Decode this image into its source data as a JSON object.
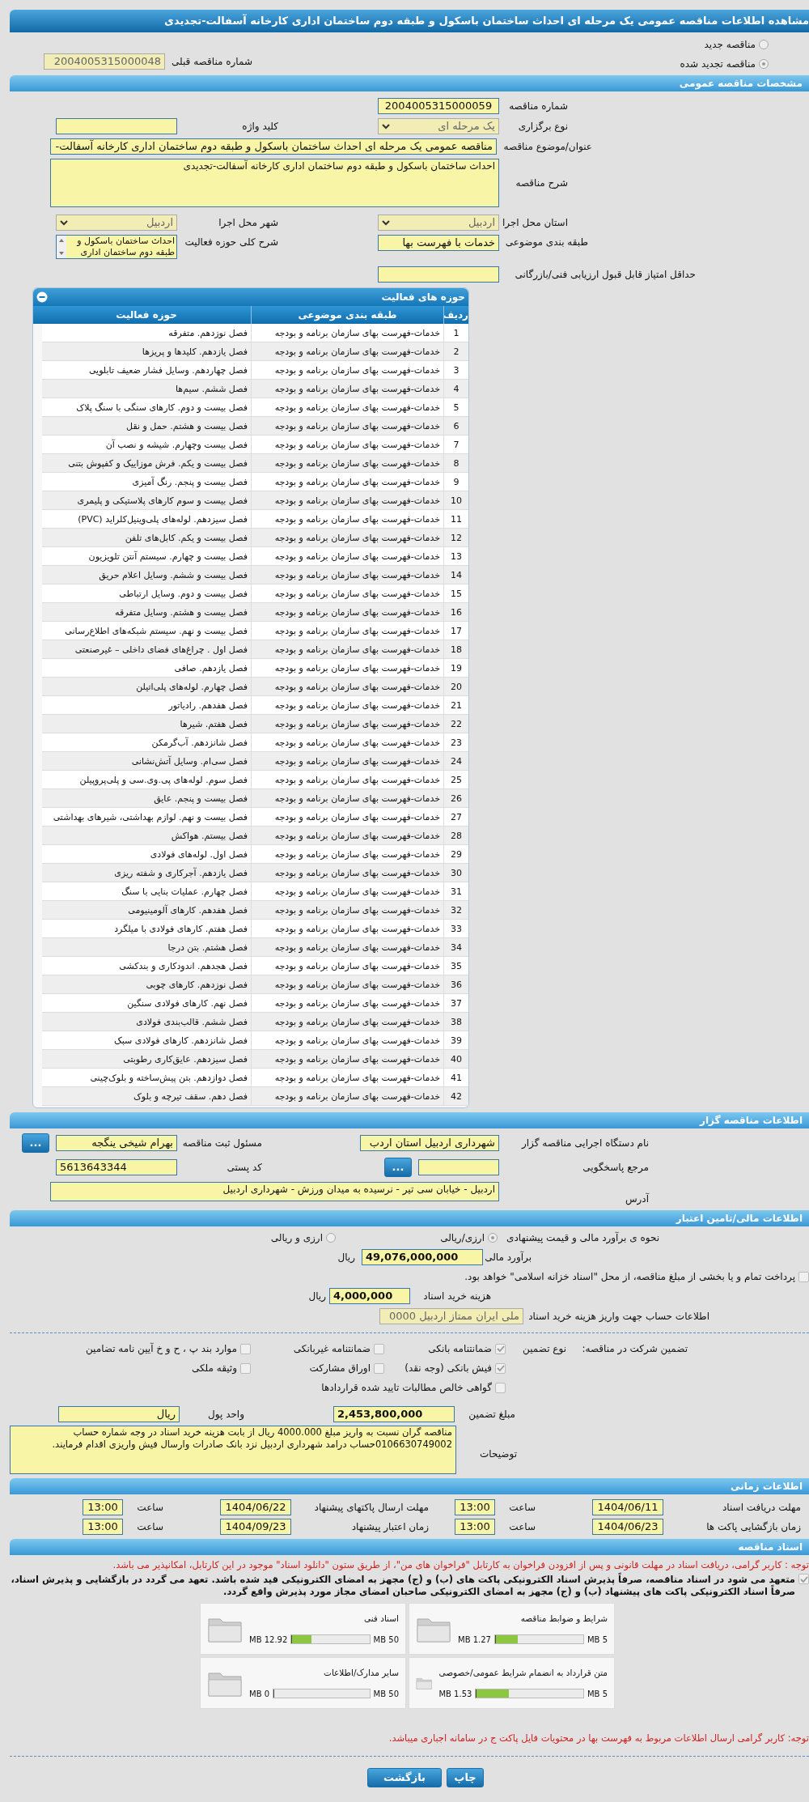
{
  "page_title": "مشاهده اطلاعات مناقصه عمومی یک مرحله ای احداث ساختمان باسکول و طبقه دوم ساختمان اداری کارخانه آسفالت-تجدیدی",
  "tender_status": [
    {
      "label": "مناقصه جدید",
      "selected": false
    },
    {
      "label": "مناقصه تجدید شده",
      "selected": true
    }
  ],
  "previous_tender": {
    "label": "شماره مناقصه قبلی",
    "value": "2004005315000048"
  },
  "general": {
    "title": "مشخصات مناقصه عمومی",
    "tender_number": {
      "label": "شماره مناقصه",
      "value": "2004005315000059"
    },
    "holding_type": {
      "label": "نوع برگزاری",
      "value": "یک مرحله ای"
    },
    "keyword": {
      "label": "کلید واژه"
    },
    "subject": {
      "label": "عنوان/موضوع مناقصه",
      "value": "مناقصه عمومی یک مرحله ای احداث ساختمان باسکول و طبقه دوم ساختمان اداری کارخانه آسفالت-"
    },
    "description": {
      "label": "شرح مناقصه",
      "value": "احداث ساختمان باسکول و طبقه دوم ساختمان اداری کارخانه آسفالت-تجدیدی"
    },
    "province": {
      "label": "استان محل اجرا",
      "value": "اردبیل"
    },
    "city": {
      "label": "شهر محل اجرا",
      "value": "اردبیل"
    },
    "category": {
      "label": "طبقه بندی موضوعی",
      "value": "خدمات با فهرست بها"
    },
    "activity_summary": {
      "label": "شرح کلی حوزه فعالیت",
      "value": "احداث ساختمان باسکول و طبقه دوم ساختمان اداری"
    },
    "min_score": {
      "label": "حداقل امتیاز قابل قبول ارزیابی فنی/بازرگانی"
    }
  },
  "activities": {
    "title": "حوزه های فعالیت",
    "columns": [
      "ردیف",
      "طبقه بندی موضوعی",
      "حوزه فعالیت"
    ],
    "rows": [
      {
        "no": "1",
        "category": "خدمات-فهرست بهای سازمان برنامه و بودجه",
        "activity": "فصل نوزدهم. متفرقه"
      },
      {
        "no": "2",
        "category": "خدمات-فهرست بهای سازمان برنامه و بودجه",
        "activity": "فصل یازدهم. کلیدها و پریزها"
      },
      {
        "no": "3",
        "category": "خدمات-فهرست بهای سازمان برنامه و بودجه",
        "activity": "فصل چهاردهم. وسایل فشار ضعیف تابلویی"
      },
      {
        "no": "4",
        "category": "خدمات-فهرست بهای سازمان برنامه و بودجه",
        "activity": "فصل ششم. سیم‌ها"
      },
      {
        "no": "5",
        "category": "خدمات-فهرست بهای سازمان برنامه و بودجه",
        "activity": "فصل بیست و دوم. کارهای سنگی با سنگ پلاک"
      },
      {
        "no": "6",
        "category": "خدمات-فهرست بهای سازمان برنامه و بودجه",
        "activity": "فصل بیست و هشتم. حمل و نقل"
      },
      {
        "no": "7",
        "category": "خدمات-فهرست بهای سازمان برنامه و بودجه",
        "activity": "فصل بیست وچهارم. شیشه و نصب آن"
      },
      {
        "no": "8",
        "category": "خدمات-فهرست بهای سازمان برنامه و بودجه",
        "activity": "فصل بیست و یکم. فرش موزاییک و کفپوش بتنی"
      },
      {
        "no": "9",
        "category": "خدمات-فهرست بهای سازمان برنامه و بودجه",
        "activity": "فصل بیست و پنجم. رنگ آمیزی"
      },
      {
        "no": "10",
        "category": "خدمات-فهرست بهای سازمان برنامه و بودجه",
        "activity": "فصل بیست و سوم کارهای پلاستیکی و پلیمری"
      },
      {
        "no": "11",
        "category": "خدمات-فهرست بهای سازمان برنامه و بودجه",
        "activity": "فصل سیزدهم. لوله‌های پلی‌وینیل‌کلراید (PVC)"
      },
      {
        "no": "12",
        "category": "خدمات-فهرست بهای سازمان برنامه و بودجه",
        "activity": "فصل بیست و یکم. کابل‌های تلفن"
      },
      {
        "no": "13",
        "category": "خدمات-فهرست بهای سازمان برنامه و بودجه",
        "activity": "فصل بیست و چهارم. سیستم آنتن تلویزیون"
      },
      {
        "no": "14",
        "category": "خدمات-فهرست بهای سازمان برنامه و بودجه",
        "activity": "فصل بیست و ششم. وسایل اعلام حریق"
      },
      {
        "no": "15",
        "category": "خدمات-فهرست بهای سازمان برنامه و بودجه",
        "activity": "فصل بیست و دوم. وسایل ارتباطی"
      },
      {
        "no": "16",
        "category": "خدمات-فهرست بهای سازمان برنامه و بودجه",
        "activity": "فصل بیست و هشتم. وسایل متفرقه"
      },
      {
        "no": "17",
        "category": "خدمات-فهرست بهای سازمان برنامه و بودجه",
        "activity": "فصل بیست و نهم. سیستم شبکه‌های اطلاع‌رسانی"
      },
      {
        "no": "18",
        "category": "خدمات-فهرست بهای سازمان برنامه و بودجه",
        "activity": "فصل اول . چراغ‌های فضای داخلی – غیرصنعتی"
      },
      {
        "no": "19",
        "category": "خدمات-فهرست بهای سازمان برنامه و بودجه",
        "activity": "فصل یازدهم. صافی"
      },
      {
        "no": "20",
        "category": "خدمات-فهرست بهای سازمان برنامه و بودجه",
        "activity": "فصل چهارم. لوله‌های پلی‌اتیلن"
      },
      {
        "no": "21",
        "category": "خدمات-فهرست بهای سازمان برنامه و بودجه",
        "activity": "فصل هفدهم. رادیاتور"
      },
      {
        "no": "22",
        "category": "خدمات-فهرست بهای سازمان برنامه و بودجه",
        "activity": "فصل هفتم. شیرها"
      },
      {
        "no": "23",
        "category": "خدمات-فهرست بهای سازمان برنامه و بودجه",
        "activity": "فصل شانزدهم. آب‌گرمکن"
      },
      {
        "no": "24",
        "category": "خدمات-فهرست بهای سازمان برنامه و بودجه",
        "activity": "فصل سی‌ام. وسایل آتش‌نشانی"
      },
      {
        "no": "25",
        "category": "خدمات-فهرست بهای سازمان برنامه و بودجه",
        "activity": "فصل سوم. لوله‌های پی.وی.سی و پلی‌پروپیلن"
      },
      {
        "no": "26",
        "category": "خدمات-فهرست بهای سازمان برنامه و بودجه",
        "activity": "فصل بیست و پنجم. عایق"
      },
      {
        "no": "27",
        "category": "خدمات-فهرست بهای سازمان برنامه و بودجه",
        "activity": "فصل بیست و نهم. لوازم بهداشتی، شیرهای بهداشتی"
      },
      {
        "no": "28",
        "category": "خدمات-فهرست بهای سازمان برنامه و بودجه",
        "activity": "فصل بیستم. هواکش"
      },
      {
        "no": "29",
        "category": "خدمات-فهرست بهای سازمان برنامه و بودجه",
        "activity": "فصل اول. لوله‌های فولادی"
      },
      {
        "no": "30",
        "category": "خدمات-فهرست بهای سازمان برنامه و بودجه",
        "activity": "فصل یازدهم. آجرکاری و شفته ریزی"
      },
      {
        "no": "31",
        "category": "خدمات-فهرست بهای سازمان برنامه و بودجه",
        "activity": "فصل چهارم. عملیات بنایی با سنگ"
      },
      {
        "no": "32",
        "category": "خدمات-فهرست بهای سازمان برنامه و بودجه",
        "activity": "فصل هفدهم. کارهای آلومینیومی"
      },
      {
        "no": "33",
        "category": "خدمات-فهرست بهای سازمان برنامه و بودجه",
        "activity": "فصل هفتم. کارهای فولادی با میلگرد"
      },
      {
        "no": "34",
        "category": "خدمات-فهرست بهای سازمان برنامه و بودجه",
        "activity": "فصل هشتم. بتن درجا"
      },
      {
        "no": "35",
        "category": "خدمات-فهرست بهای سازمان برنامه و بودجه",
        "activity": "فصل هجدهم. اندودکاری و بندکشی"
      },
      {
        "no": "36",
        "category": "خدمات-فهرست بهای سازمان برنامه و بودجه",
        "activity": "فصل نوزدهم. کارهای چوبی"
      },
      {
        "no": "37",
        "category": "خدمات-فهرست بهای سازمان برنامه و بودجه",
        "activity": "فصل نهم. کارهای فولادی سنگین"
      },
      {
        "no": "38",
        "category": "خدمات-فهرست بهای سازمان برنامه و بودجه",
        "activity": "فصل ششم. قالب‌بندی فولادی"
      },
      {
        "no": "39",
        "category": "خدمات-فهرست بهای سازمان برنامه و بودجه",
        "activity": "فصل شانزدهم. کارهای فولادی سبک"
      },
      {
        "no": "40",
        "category": "خدمات-فهرست بهای سازمان برنامه و بودجه",
        "activity": "فصل سیزدهم. عایق‌کاری رطوبتی"
      },
      {
        "no": "41",
        "category": "خدمات-فهرست بهای سازمان برنامه و بودجه",
        "activity": "فصل دوازدهم. بتن پیش‌ساخته و بلوک‌چینی"
      },
      {
        "no": "42",
        "category": "خدمات-فهرست بهای سازمان برنامه و بودجه",
        "activity": "فصل دهم. سقف تیرچه و بلوک"
      }
    ]
  },
  "organizer": {
    "title": "اطلاعات مناقصه گزار",
    "organization": {
      "label": "نام دستگاه اجرایی مناقصه گزار",
      "value": "شهرداری اردبیل استان اردب"
    },
    "registrar": {
      "label": "مسئول ثبت مناقصه",
      "value": "بهرام شیخی ینگجه",
      "button": "..."
    },
    "reference": {
      "label": "مرجع پاسخگویی",
      "button": "..."
    },
    "postal_code": {
      "label": "کد پستی",
      "value": "5613643344"
    },
    "address": {
      "label": "آدرس",
      "value": "اردبیل - خیابان سی تیر - نرسیده به میدان ورزش - شهرداری اردبیل"
    }
  },
  "finance": {
    "title": "اطلاعات مالی/تامین اعتبار",
    "estimate_method": {
      "label": "نحوه ی برآورد مالی و قیمت پیشنهادی",
      "options": [
        {
          "label": "ارزی/ریالی",
          "selected": true
        },
        {
          "label": "ارزی و ریالی",
          "selected": false
        }
      ]
    },
    "estimate": {
      "label": "برآورد مالی",
      "value": "49,076,000,000",
      "unit": "ریال"
    },
    "treasury": {
      "label": "پرداخت تمام و یا بخشی از مبلغ مناقصه، از محل \"اسناد خزانه اسلامی\" خواهد بود.",
      "checked": false
    },
    "document_fee": {
      "label": "هزینه خرید اسناد",
      "value": "4,000,000",
      "unit": "ریال"
    },
    "fee_account": {
      "label": "اطلاعات حساب جهت واریز هزینه خرید اسناد",
      "value": "ملی ایران ممتاز اردبیل 0000"
    }
  },
  "guarantee": {
    "label": "تضمین شرکت در مناقصه:",
    "type_label": "نوع تضمین",
    "options": [
      {
        "label": "ضمانتنامه بانکی",
        "checked": true
      },
      {
        "label": "ضمانتنامه غیربانکی",
        "checked": false
      },
      {
        "label": "موارد بند پ ، ح و خ آیین نامه تضامین",
        "checked": false
      },
      {
        "label": "فیش بانکی (وجه نقد)",
        "checked": true
      },
      {
        "label": "اوراق مشارکت",
        "checked": false
      },
      {
        "label": "وثیقه ملکی",
        "checked": false
      },
      {
        "label": "گواهی خالص مطالبات تایید شده قراردادها",
        "checked": false
      }
    ],
    "amount": {
      "label": "مبلغ تضمین",
      "value": "2,453,800,000"
    },
    "currency": {
      "label": "واحد پول",
      "value": "ریال"
    },
    "notes": {
      "label": "توضیحات",
      "value": "مناقصه گران نسبت به واریز مبلغ 4000.000 ریال از بابت هزینه خرید اسناد در وجه شماره حساب 0106630749002حساب درامد شهرداری اردبیل نزد بانک صادرات وارسال فیش واریزی اقدام فرمایند."
    }
  },
  "timing": {
    "title": "اطلاعات زمانی",
    "items": [
      {
        "label": "مهلت دریافت اسناد",
        "date": "1404/06/11",
        "time_label": "ساعت",
        "time": "13:00"
      },
      {
        "label": "مهلت ارسال پاکتهای پیشنهاد",
        "date": "1404/06/22",
        "time_label": "ساعت",
        "time": "13:00"
      },
      {
        "label": "زمان بازگشایی پاکت ها",
        "date": "1404/06/23",
        "time_label": "ساعت",
        "time": "13:00"
      },
      {
        "label": "زمان اعتبار پیشنهاد",
        "date": "1404/09/23",
        "time_label": "ساعت",
        "time": "13:00"
      }
    ]
  },
  "documents": {
    "title": "اسناد مناقصه",
    "notice": "توجه : کاربر گرامی، دریافت اسناد در مهلت قانونی و پس از افزودن فراخوان به کارتابل \"فراخوان های من\"، از طریق ستون \"دانلود اسناد\" موجود در این کارتابل، امکانپذیر می باشد.",
    "commitment": {
      "label": "متعهد می شود در اسناد مناقصه، صرفاً پذیرش اسناد الکترونیکی پاکت های (ب) و (ج) مجهز به امضای الکترونیکی قید شده باشد. تعهد می گردد در بازگشایی و پذیرش اسناد، صرفاً اسناد الکترونیکی پاکت های پیشنهاد (ب) و (ج) مجهز به امضای الکترونیکی صاحبان امضای مجاز مورد پذیرش واقع گردد.",
      "checked": true
    },
    "files": [
      {
        "name": "شرایط و ضوابط مناقصه",
        "size": "1.27 MB",
        "max": "5 MB",
        "level": 0.254
      },
      {
        "name": "اسناد فنی",
        "size": "12.92 MB",
        "max": "50 MB",
        "level": 0.258
      },
      {
        "name": "متن قرارداد به انضمام شرایط عمومی/خصوصی",
        "size": "1.53 MB",
        "max": "5 MB",
        "level": 0.306
      },
      {
        "name": "سایر مدارک/اطلاعات",
        "size": "0 MB",
        "max": "50 MB",
        "level": 0
      }
    ],
    "footer_note": "توجه: کاربر گرامی ارسال اطلاعات مربوط به فهرست بها در محتویات فایل پاکت ج در سامانه اجباری میباشد."
  },
  "buttons": [
    {
      "label": "چاپ"
    },
    {
      "label": "بازگشت"
    }
  ]
}
